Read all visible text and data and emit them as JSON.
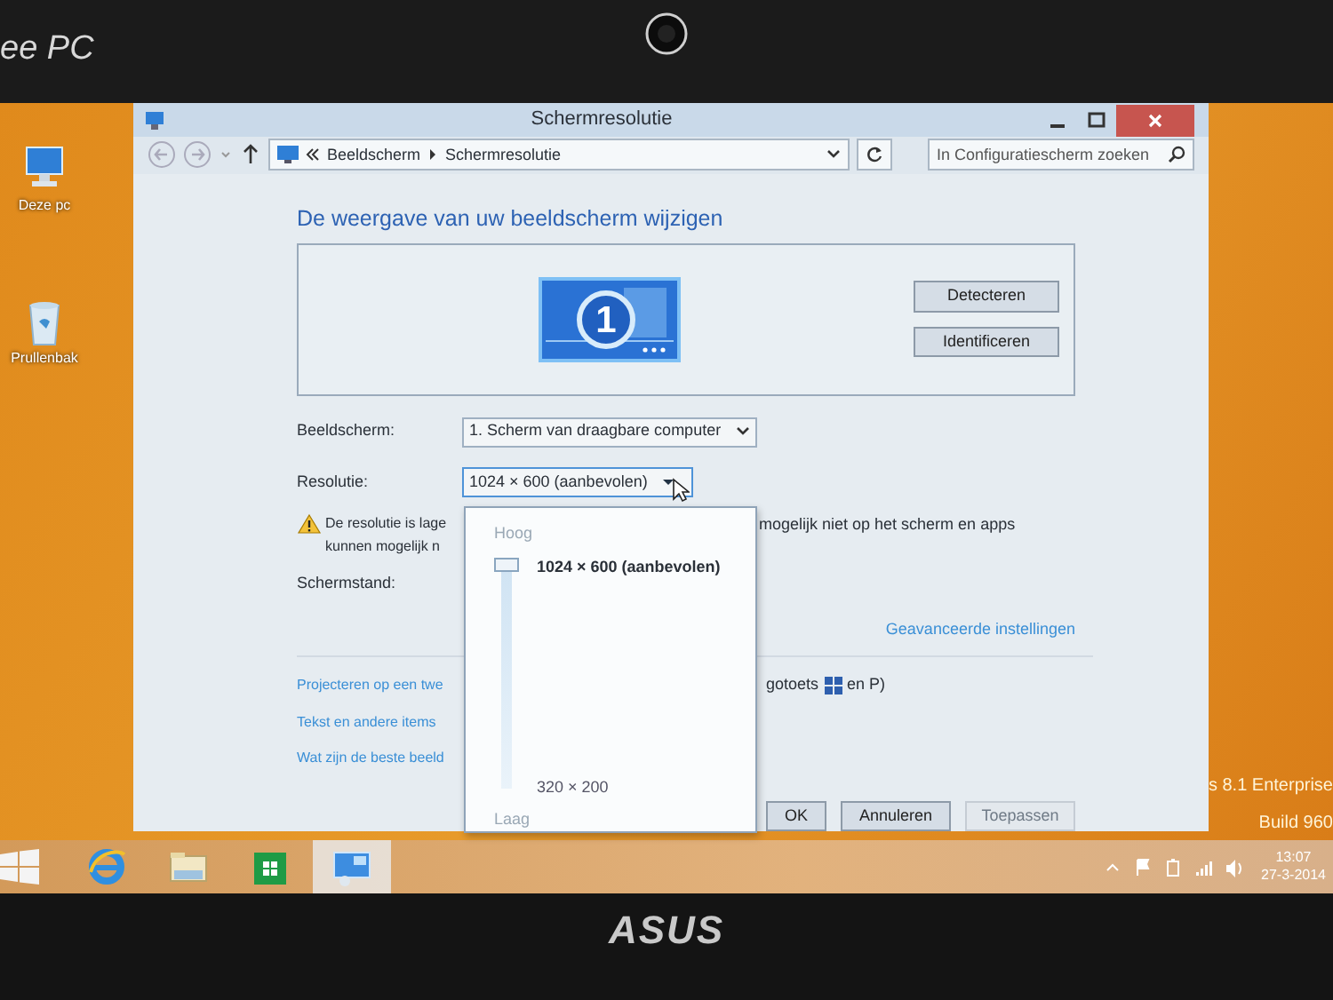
{
  "bezel": {
    "brand_top": "ee PC",
    "brand_bottom": "ASUS"
  },
  "desktop": {
    "icons": [
      {
        "label": "Deze pc",
        "kind": "computer"
      },
      {
        "label": "Prullenbak",
        "kind": "recycle"
      }
    ],
    "edition_lines": [
      "s 8.1 Enterprise",
      "Build 960"
    ]
  },
  "window": {
    "title": "Schermresolutie",
    "breadcrumb": [
      "Beeldscherm",
      "Schermresolutie"
    ],
    "search": {
      "placeholder": "In Configuratiescherm zoeken"
    },
    "heading": "De weergave van uw beeldscherm wijzigen",
    "monitor_preview": {
      "number": "1",
      "buttons": [
        "Detecteren",
        "Identificeren"
      ]
    },
    "settings": [
      {
        "label": "Beeldscherm:",
        "value": "1. Scherm van draagbare computer",
        "expanded": false
      },
      {
        "label": "Resolutie:",
        "value": "1024 × 600 (aanbevolen)",
        "expanded": true
      }
    ],
    "warning": {
      "line1_start": "De resolutie is lage",
      "line1_end": "mogelijk niet op het scherm en apps",
      "line2_start": "kunnen mogelijk n"
    },
    "orientation_label": "Schermstand:",
    "advanced_link": "Geavanceerde instellingen",
    "links": [
      {
        "start": "Projecteren op een twe",
        "end": "gotoets",
        "after_key": "en P)"
      },
      {
        "start": "Tekst en andere items"
      },
      {
        "start": "Wat zijn de beste beeld"
      }
    ],
    "buttons": [
      {
        "label": "OK",
        "disabled": false
      },
      {
        "label": "Annuleren",
        "disabled": false
      },
      {
        "label": "Toepassen",
        "disabled": true
      }
    ]
  },
  "resolution_popup": {
    "top_label": "Hoog",
    "max_option": "1024 × 600 (aanbevolen)",
    "min_option": "320 × 200",
    "bottom_label": "Laag",
    "level": 1
  },
  "taskbar": {
    "apps": [
      {
        "kind": "browser",
        "selected": false
      },
      {
        "kind": "folder",
        "selected": false
      },
      {
        "kind": "store",
        "selected": false
      },
      {
        "kind": "control-panel",
        "selected": true
      }
    ],
    "clock": {
      "time": "13:07",
      "date": "27-3-2014"
    }
  }
}
